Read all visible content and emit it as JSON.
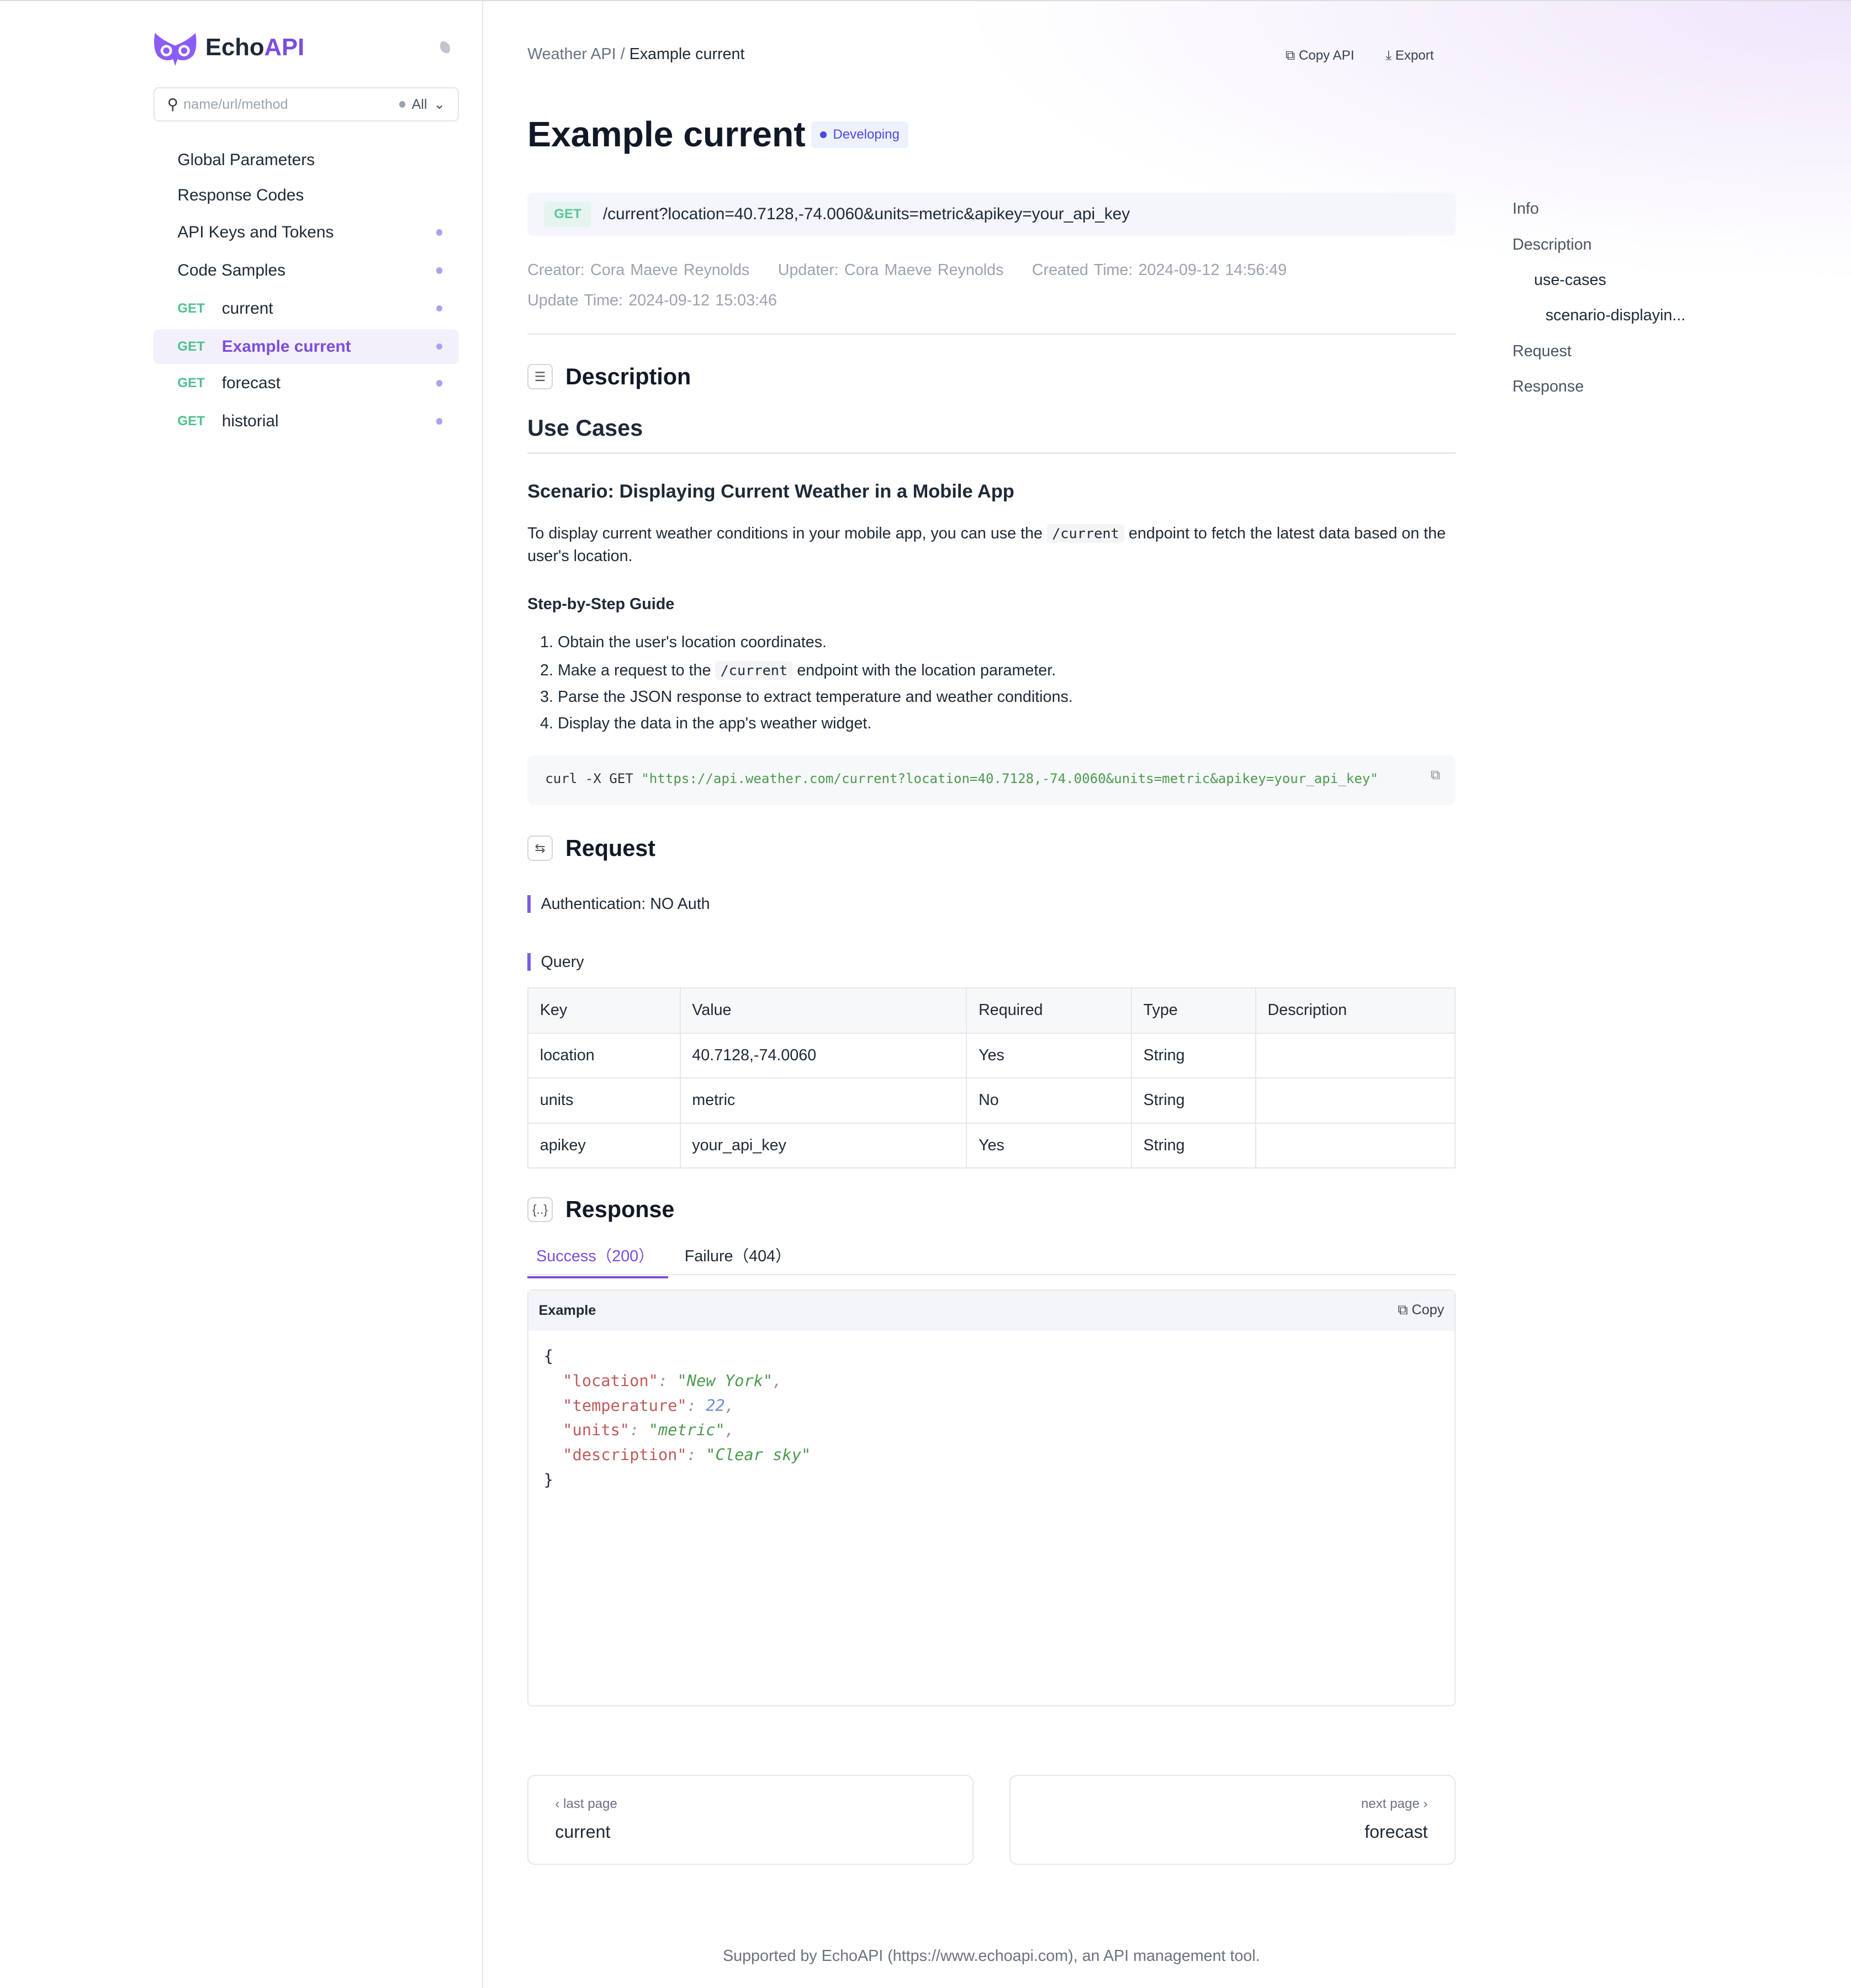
{
  "sidebar": {
    "logo_main": "Echo",
    "logo_accent": "API",
    "search_placeholder": "name/url/method",
    "filter": "All",
    "items": [
      {
        "label": "Global Parameters",
        "method": ""
      },
      {
        "label": "Response Codes",
        "method": ""
      },
      {
        "label": "API Keys and Tokens",
        "method": ""
      },
      {
        "label": "Code Samples",
        "method": ""
      },
      {
        "label": "current",
        "method": "GET"
      },
      {
        "label": "Example current",
        "method": "GET"
      },
      {
        "label": "forecast",
        "method": "GET"
      },
      {
        "label": "historial",
        "method": "GET"
      }
    ]
  },
  "header": {
    "crumb_parent": "Weather API",
    "crumb_sep": "/",
    "crumb_current": "Example current",
    "copy_api": "Copy API",
    "export": "Export"
  },
  "page": {
    "title": "Example current",
    "status": "Developing",
    "method": "GET",
    "url": "/current?location=40.7128,-74.0060&units=metric&apikey=your_api_key",
    "creator": "Creator: Cora Maeve Reynolds",
    "updater": "Updater: Cora Maeve Reynolds",
    "created": "Created Time: 2024-09-12 14:56:49",
    "updated": "Update Time: 2024-09-12 15:03:46"
  },
  "description": {
    "heading": "Description",
    "h2": "Use Cases",
    "h3": "Scenario: Displaying Current Weather in a Mobile App",
    "p_before": "To display current weather conditions in your mobile app, you can use the ",
    "p_code": "/current",
    "p_after": " endpoint to fetch the latest data based on the user's location.",
    "guide": "Step-by-Step Guide",
    "steps": [
      "1. Obtain the user's location coordinates.",
      "2. Make a request to the ",
      "3. Parse the JSON response to extract temperature and weather conditions.",
      "4. Display the data in the app's weather widget."
    ],
    "step2_code": "/current",
    "step2_after": " endpoint with the location parameter.",
    "curl_cmd": "curl -X GET ",
    "curl_url": "\"https://api.weather.com/current?location=40.7128,-74.0060&units=metric&apikey=your_api_key\""
  },
  "request": {
    "heading": "Request",
    "auth_label": "Authentication: ",
    "auth_value": "NO Auth",
    "query": "Query",
    "columns": [
      "Key",
      "Value",
      "Required",
      "Type",
      "Description"
    ],
    "rows": [
      [
        "location",
        "40.7128,-74.0060",
        "Yes",
        "String",
        ""
      ],
      [
        "units",
        "metric",
        "No",
        "String",
        ""
      ],
      [
        "apikey",
        "your_api_key",
        "Yes",
        "String",
        ""
      ]
    ]
  },
  "response": {
    "heading": "Response",
    "tabs": [
      "Success（200）",
      "Failure（404）"
    ],
    "example": "Example",
    "copy": "Copy",
    "json": {
      "open": "{",
      "close": "}",
      "lines": [
        {
          "key": "\"location\"",
          "val": "\"New York\"",
          "type": "s"
        },
        {
          "key": "\"temperature\"",
          "val": "22",
          "type": "n"
        },
        {
          "key": "\"units\"",
          "val": "\"metric\"",
          "type": "s"
        },
        {
          "key": "\"description\"",
          "val": "\"Clear sky\"",
          "type": "s"
        }
      ]
    }
  },
  "pager": {
    "prev_label": "last page",
    "prev": "current",
    "next_label": "next page",
    "next": "forecast"
  },
  "toc": [
    "Info",
    "Description",
    "use-cases",
    "scenario-displayin...",
    "Request",
    "Response"
  ],
  "footer": "Supported by EchoAPI (https://www.echoapi.com), an API management tool.",
  "colors": {
    "accent": "#7c4ddb",
    "get": "#4fc08d"
  }
}
